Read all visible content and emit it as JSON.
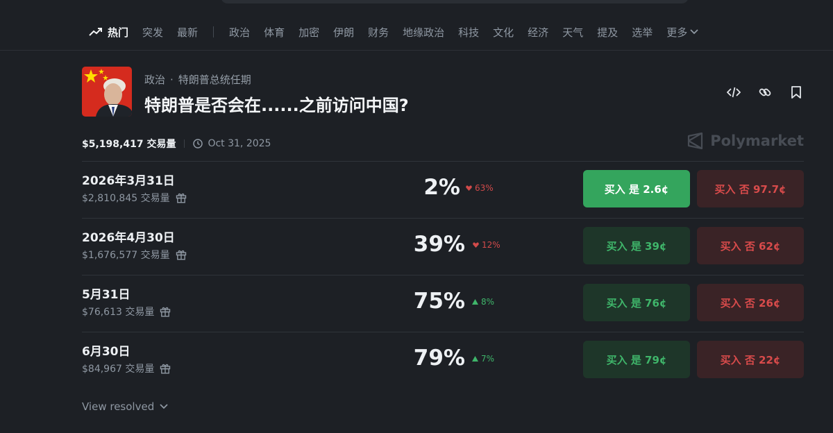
{
  "nav": {
    "hot": "热门",
    "items": [
      "突发",
      "最新"
    ],
    "categories": [
      "政治",
      "体育",
      "加密",
      "伊朗",
      "财务",
      "地缘政治",
      "科技",
      "文化",
      "经济",
      "天气",
      "提及",
      "选举"
    ],
    "more": "更多"
  },
  "market": {
    "category": "政治",
    "subcategory": "特朗普总统任期",
    "title": "特朗普是否会在......之前访问中国?",
    "total_volume": "$5,198,417 交易量",
    "end_date": "Oct 31, 2025",
    "brand": "Polymarket"
  },
  "outcomes": [
    {
      "date": "2026年3月31日",
      "volume": "$2,810,845 交易量",
      "probability": "2%",
      "change": "63%",
      "direction": "down",
      "buy_yes": "买入 是 2.6¢",
      "buy_no": "买入 否 97.7¢"
    },
    {
      "date": "2026年4月30日",
      "volume": "$1,676,577 交易量",
      "probability": "39%",
      "change": "12%",
      "direction": "down",
      "buy_yes": "买入 是 39¢",
      "buy_no": "买入 否 62¢"
    },
    {
      "date": "5月31日",
      "volume": "$76,613 交易量",
      "probability": "75%",
      "change": "8%",
      "direction": "up",
      "buy_yes": "买入 是 76¢",
      "buy_no": "买入 否 26¢"
    },
    {
      "date": "6月30日",
      "volume": "$84,967 交易量",
      "probability": "79%",
      "change": "7%",
      "direction": "up",
      "buy_yes": "买入 是 79¢",
      "buy_no": "买入 否 22¢"
    }
  ],
  "footer": {
    "view_resolved": "View resolved"
  },
  "colors": {
    "background": "#1d2025",
    "up": "#3fb56a",
    "down": "#d24a4a",
    "yes_button": "#34a55d",
    "no_button": "#3a2326"
  }
}
